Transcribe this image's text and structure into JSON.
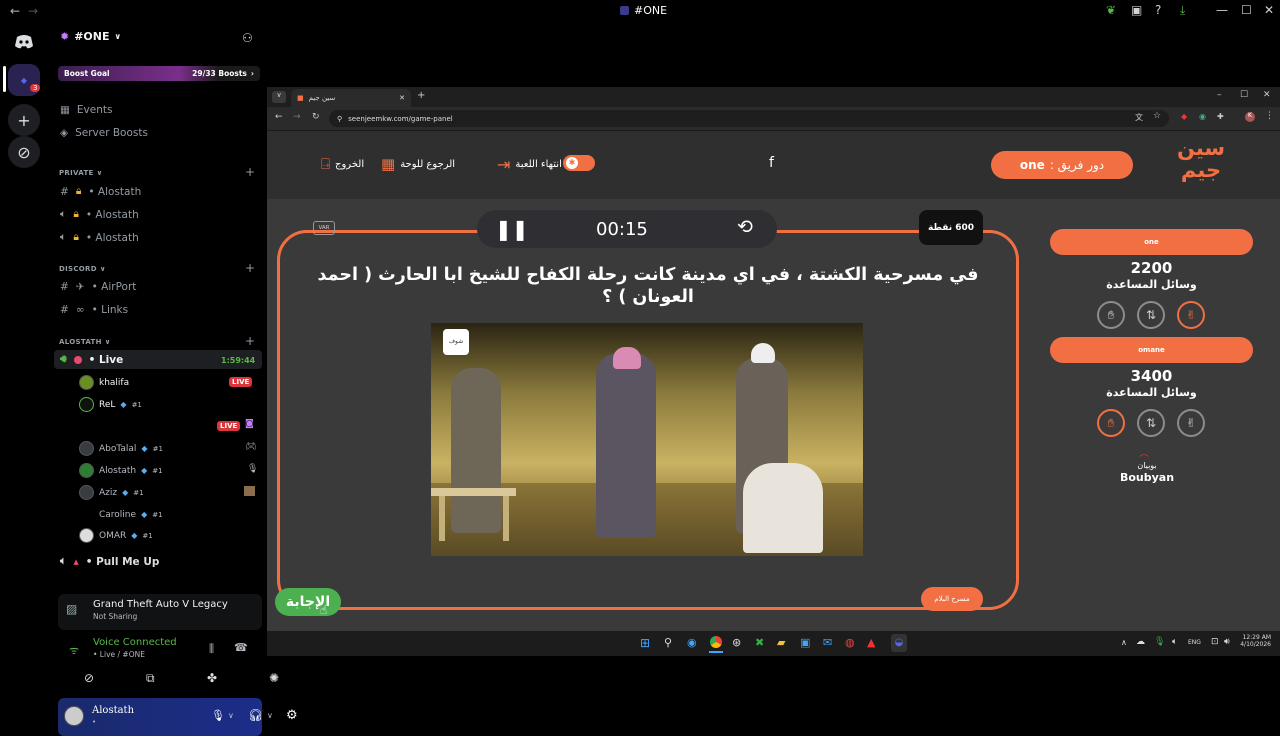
{
  "window": {
    "title": "#ONE"
  },
  "server": {
    "name": "#ONE",
    "boost_goal_label": "Boost Goal",
    "boost_count": "29/33 Boosts",
    "rail_badge": "3",
    "links": [
      {
        "label": "Events"
      },
      {
        "label": "Server Boosts"
      }
    ]
  },
  "categories": {
    "private": "PRIVATE",
    "discord": "DISCORD",
    "alostath": "ALOSTATH"
  },
  "private_channels": [
    {
      "label": "• Alostath"
    },
    {
      "label": "• Alostath"
    },
    {
      "label": "• Alostath"
    }
  ],
  "discord_channels": [
    {
      "label": "• AirPort"
    },
    {
      "label": "• Links"
    }
  ],
  "live_channel": {
    "label": "• Live",
    "timer": "1:59:44"
  },
  "voice_users": [
    {
      "name": "khalifa",
      "rank": "",
      "live": "LIVE"
    },
    {
      "name": "ReL",
      "rank": "#1",
      "live": "LIVE"
    },
    {
      "name": "AboTalal",
      "rank": "#1",
      "live": ""
    },
    {
      "name": "Alostath",
      "rank": "#1",
      "live": ""
    },
    {
      "name": "Aziz",
      "rank": "#1",
      "live": ""
    },
    {
      "name": "Caroline",
      "rank": "#1",
      "live": ""
    },
    {
      "name": "OMAR",
      "rank": "#1",
      "live": ""
    }
  ],
  "pull_me_up": {
    "label": "• Pull Me Up"
  },
  "activity": {
    "title": "Grand Theft Auto V Legacy",
    "status": "Not Sharing"
  },
  "voice": {
    "status": "Voice Connected",
    "channel": "• Live / #ONE"
  },
  "self_user": {
    "name": "Alostath",
    "status": "•"
  },
  "browser": {
    "tab_title": "سين جيم",
    "url": "seenjeemkw.com/game-panel"
  },
  "game": {
    "logo_text": "سين جيم",
    "turn_label": "دور فريق :",
    "turn_team": "one",
    "center_letter": "f",
    "end_game": "انتهاء اللعبة",
    "back_to_board": "الرجوع للوحة",
    "exit": "الخروج",
    "timer": "00:15",
    "points": "600 نقطة",
    "var_label": "VAR",
    "question": "في مسرحية الكشتة ، في اي مدينة كانت رحلة الكفاح للشيخ ابا الحارث ( احمد العونان ) ؟",
    "image_watermark": "شوف",
    "category_tag": "مسرح البلام",
    "answer_button": "الإجابة",
    "helpers_label": "وسائل المساعدة",
    "teams": [
      {
        "name": "one",
        "score": "2200"
      },
      {
        "name": "omane",
        "score": "3400"
      }
    ],
    "sponsor_ar": "بوبيان",
    "sponsor_en": "Boubyan"
  },
  "taskbar": {
    "lang": "ENG",
    "time": "12:29 AM",
    "date": "4/10/2026"
  },
  "colors": {
    "accent": "#f26f44",
    "answer_green": "#4caf50",
    "live_red": "#da373c"
  }
}
